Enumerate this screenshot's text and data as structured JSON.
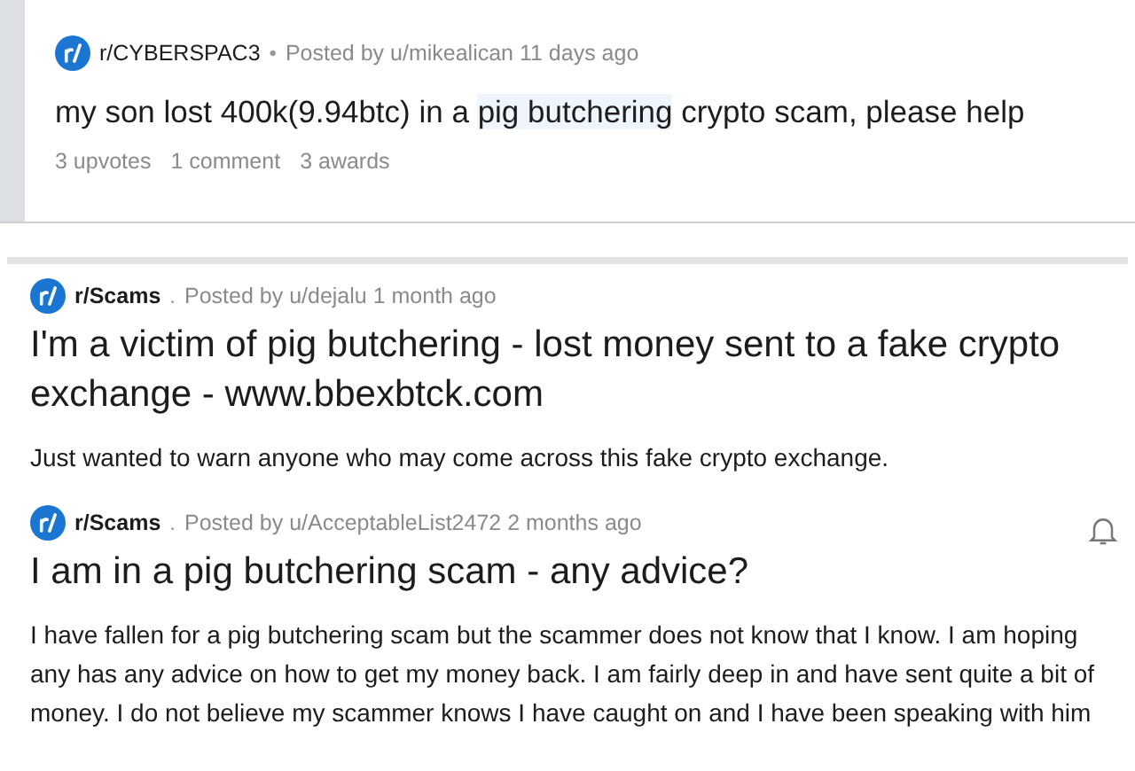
{
  "posts": [
    {
      "kind": "compact",
      "community": "r/CYBERSPAC3",
      "separator": "•",
      "meta": "Posted by u/mikealican 11 days ago",
      "title": [
        {
          "text": "my son lost 400k(9.94btc) in a ",
          "highlighted": false
        },
        {
          "text": "pig butchering",
          "highlighted": true
        },
        {
          "text": " crypto scam, please help",
          "highlighted": false
        }
      ],
      "stats": [
        "3 upvotes",
        "1 comment",
        "3 awards"
      ]
    },
    {
      "kind": "standard",
      "community": "r/Scams",
      "separator": ".",
      "meta": "Posted by u/dejalu 1 month ago",
      "title": [
        {
          "text": "I'm a victim of pig butchering - lost money sent to a fake crypto exchange - www.bbexbtck.com",
          "highlighted": false
        }
      ],
      "body": "Just wanted to warn anyone who may come across this fake crypto exchange."
    },
    {
      "kind": "followable",
      "community": "r/Scams",
      "separator": ".",
      "meta": "Posted by u/AcceptableList2472 2 months ago",
      "title": [
        {
          "text": "I am in a pig butchering scam - any advice?",
          "highlighted": false
        }
      ],
      "body": "I have fallen for a pig butchering scam but the scammer does not know that I know. I am hoping\nany has any advice on how to get my money back. I am fairly deep in and have sent quite a bit of\nmoney. I do not believe my scammer knows I have caught on and I have been speaking with him"
    }
  ]
}
